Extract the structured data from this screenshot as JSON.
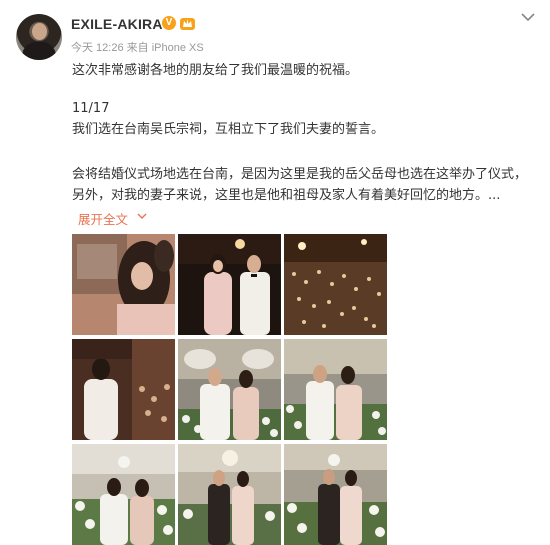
{
  "post": {
    "username": "EXILE-AKIRA",
    "verified_badge": "V",
    "meta": "今天 12:26 来自 iPhone XS",
    "paragraphs": [
      "这次非常感谢各地的朋友给了我们最温暖的祝福。",
      "11/17",
      "我们选在台南吴氏宗祠，互相立下了我们夫妻的誓言。",
      "会将结婚仪式场地选在台南，是因为这里是我的岳父岳母也选在这举办了仪式，",
      "另外，对我的妻子来说，这里也是他和祖母及家人有着美好回忆的地方。..."
    ],
    "expand_label": "展开全文",
    "photos": [
      {
        "name": "photo-couple-closeup"
      },
      {
        "name": "photo-couple-night-entrance"
      },
      {
        "name": "photo-crowd-night"
      },
      {
        "name": "photo-groom-facing-crowd"
      },
      {
        "name": "photo-couple-floral-stage"
      },
      {
        "name": "photo-couple-floral-stage-2"
      },
      {
        "name": "photo-couple-stairs-flowers"
      },
      {
        "name": "photo-couple-chandelier"
      },
      {
        "name": "photo-couple-arch-flowers"
      }
    ]
  },
  "colors": {
    "text": "#333333",
    "meta": "#999999",
    "link": "#eb7350",
    "badge": "#f7a21b"
  }
}
